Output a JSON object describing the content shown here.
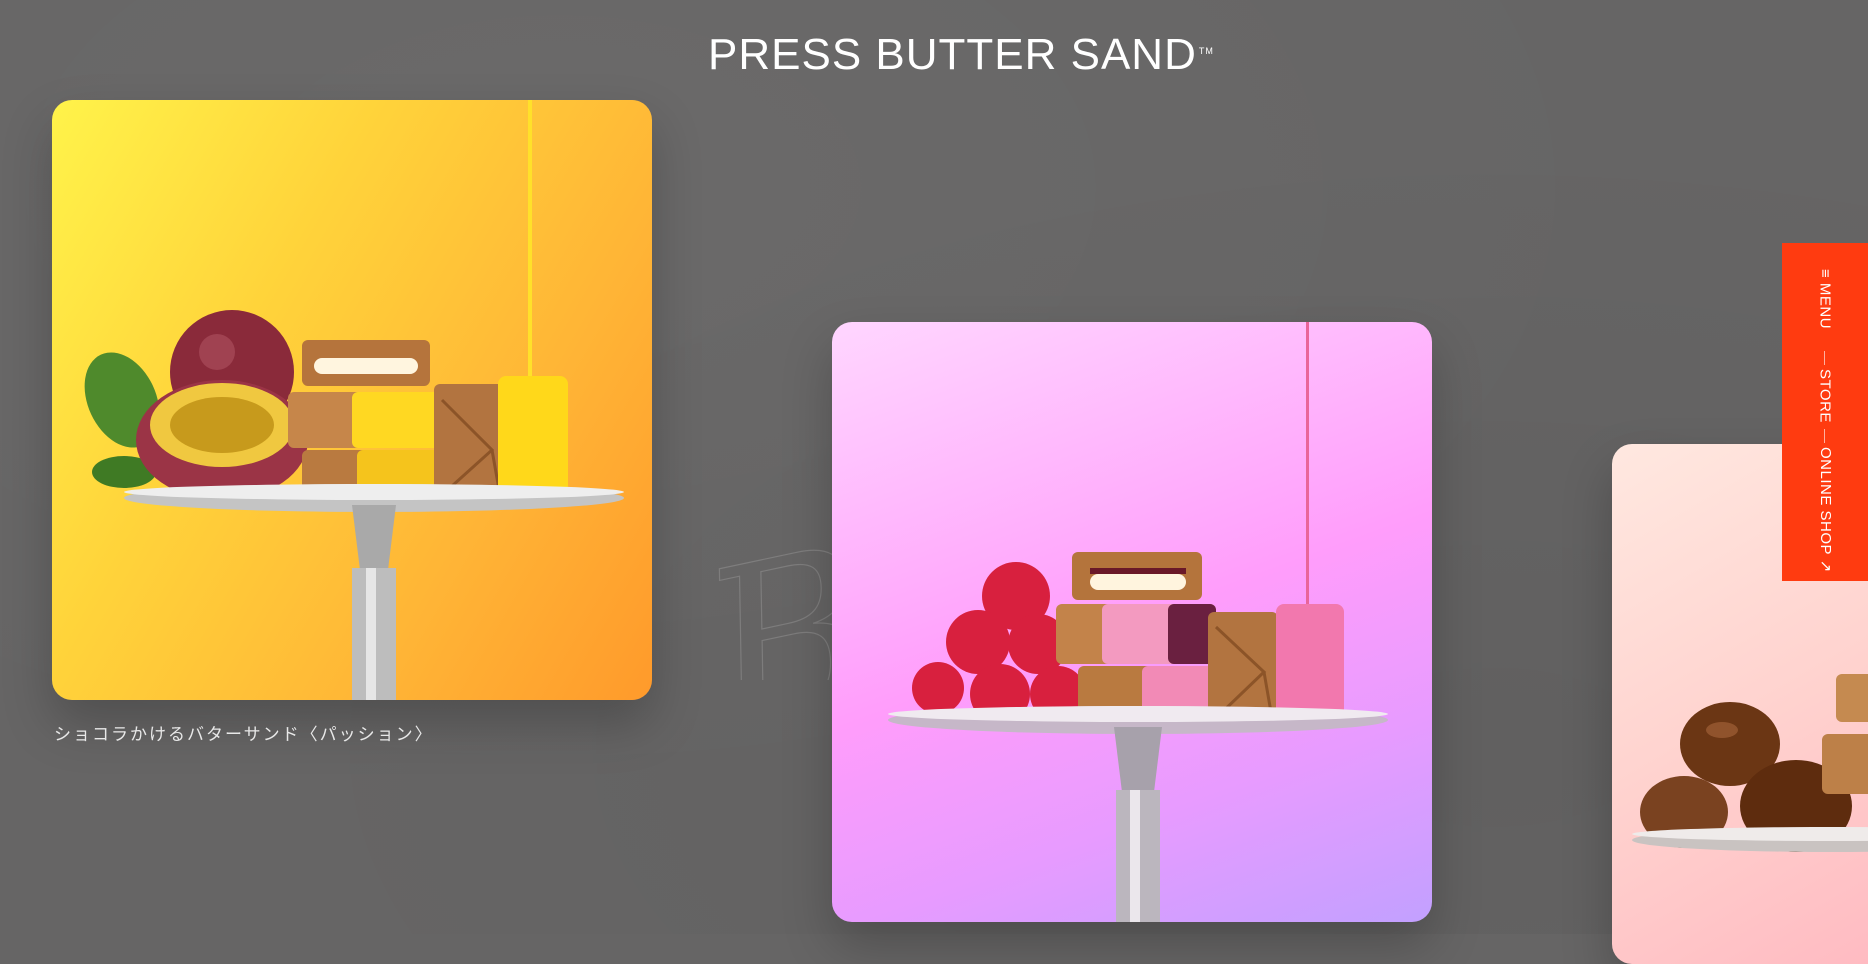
{
  "header": {
    "logo_text": "PRESS BUTTER SAND",
    "trademark": "TM"
  },
  "background": {
    "script_text": "Butter Butter"
  },
  "products": [
    {
      "name": "ショコラかけるバターサンド〈パッション〉",
      "fruit_icon": "passion-fruit",
      "drip_color": "#ffe12a",
      "coating_color": "#ffd822"
    },
    {
      "name": "",
      "fruit_icon": "raspberry",
      "drip_color": "#e9659a",
      "coating_color": "#f278ae"
    },
    {
      "name": "",
      "fruit_icon": "chestnut",
      "drip_color": "",
      "coating_color": ""
    }
  ],
  "side_menu": {
    "menu_label": "MENU",
    "store_label": "STORE",
    "shop_label": "ONLINE SHOP",
    "menu_icon": "hamburger-icon",
    "shop_icon": "arrow-up-right-icon",
    "color": "#ff3b10"
  }
}
